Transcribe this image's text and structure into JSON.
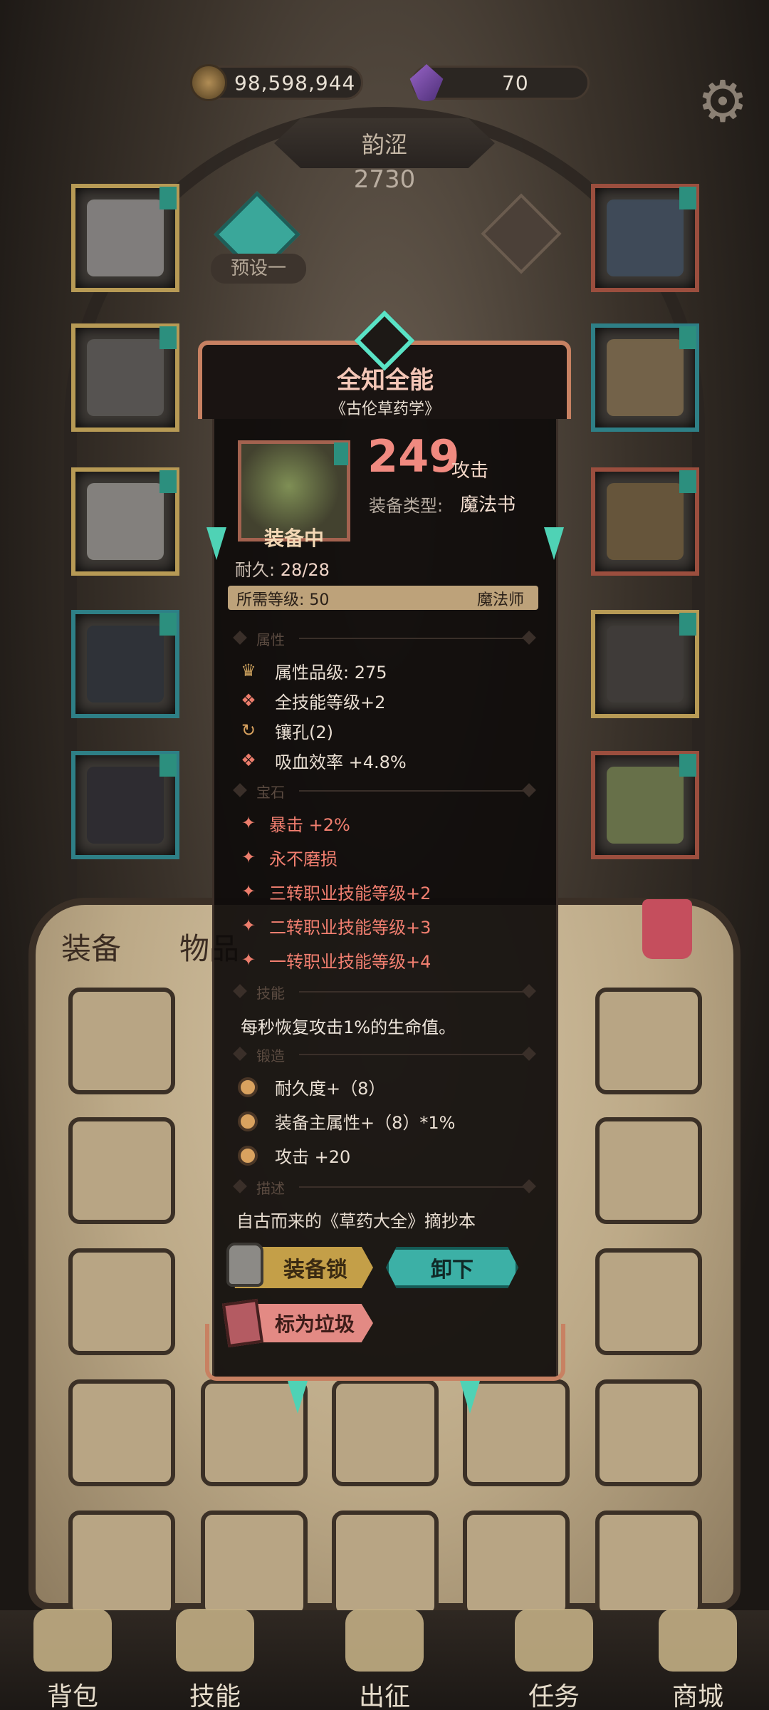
{
  "resources": {
    "gold": "98,598,944",
    "gems": "70"
  },
  "character": {
    "name": "韵涩",
    "power": "2730"
  },
  "preset": {
    "label": "预设一"
  },
  "bag_tabs": {
    "equip": "装备",
    "items": "物品"
  },
  "item": {
    "title": "全知全能",
    "subtitle": "《古伦草药学》",
    "equipped_label": "装备中",
    "attack_value": "249",
    "attack_label": "攻击",
    "type_label": "装备类型:",
    "type_value": "魔法书",
    "durability_label": "耐久:",
    "durability_value": "28/28",
    "required_level": "所需等级: 50",
    "required_class": "魔法师",
    "sections": {
      "attributes": "属性",
      "gems": "宝石",
      "skills": "技能",
      "forge": "锻造",
      "description": "描述"
    },
    "attributes": [
      {
        "icon": "quality-crown-icon",
        "text": "属性品级: 275"
      },
      {
        "icon": "skill-level-icon",
        "text": "全技能等级+2"
      },
      {
        "icon": "socket-icon",
        "text": "镶孔(2)"
      },
      {
        "icon": "lifesteal-icon",
        "text": "吸血效率 +4.8%"
      }
    ],
    "gems": [
      "暴击 +2%",
      "永不磨损",
      "三转职业技能等级+2",
      "二转职业技能等级+3",
      "一转职业技能等级+4"
    ],
    "skill_text": "每秒恢复攻击1%的生命值。",
    "forge": [
      "耐久度+（8）",
      "装备主属性+（8）*1%",
      "攻击 +20"
    ],
    "description_text": "自古而来的《草药大全》摘抄本",
    "buttons": {
      "lock": "装备锁",
      "unequip": "卸下",
      "mark_trash": "标为垃圾"
    }
  },
  "bottom_nav": [
    "背包",
    "技能",
    "出征",
    "任务",
    "商城"
  ]
}
